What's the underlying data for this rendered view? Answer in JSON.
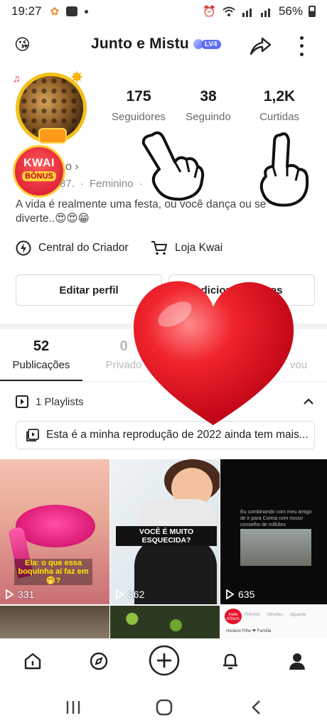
{
  "status_bar": {
    "time": "19:27",
    "battery": "56%"
  },
  "header": {
    "title": "Junto e Mistu",
    "level_badge": "LV4",
    "emoji": "😘"
  },
  "profile": {
    "stats": [
      {
        "value": "175",
        "label": "Seguidores"
      },
      {
        "value": "38",
        "label": "Seguindo"
      },
      {
        "value": "1,2K",
        "label": "Curtidas"
      }
    ],
    "kwai_bonus": {
      "line1": "KWAI",
      "line2": "BÔNUS"
    },
    "name_fragment": "o ›",
    "id_fragment": "87.",
    "gender": "Feminino",
    "bio": "A vida é realmente uma festa, ou você dança ou se diverte..😍😍😁"
  },
  "creator_links": {
    "creator_center": "Central do Criador",
    "kwai_store": "Loja Kwai"
  },
  "actions": {
    "edit_profile": "Editar perfil",
    "add_friends": "dicionar amigos"
  },
  "tabs": [
    {
      "count": "52",
      "label": "Publicações"
    },
    {
      "count": "0",
      "label": "Privado"
    },
    {
      "count": "",
      "label": "vou"
    }
  ],
  "playlists": {
    "header": "1 Playlists",
    "card_text": "Esta é a minha reprodução de 2022 ainda tem mais..."
  },
  "videos": [
    {
      "views": "331",
      "caption": "Ela: o que essa boquinha aí faz em 🤭?"
    },
    {
      "views": "362",
      "caption": "VOCÊ É MUITO ESQUECIDA?"
    },
    {
      "views": "635",
      "caption": "Eu combinando com meu amigo de ir para Coreia com nosso conselho de milhões"
    }
  ],
  "grid_row2": {
    "kwai_card_badge": "KWAI BÔNUS",
    "kwai_card_tabs": [
      "Prêmios",
      "Missões",
      "Aguarde"
    ],
    "kwai_card_user": "Horácio Filho ❤ Família"
  },
  "colors": {
    "accent_red": "#e8102a",
    "text_dark": "#1a1a1a",
    "text_grey": "#6b6b6b",
    "level_blue": "#5b6bf5"
  }
}
